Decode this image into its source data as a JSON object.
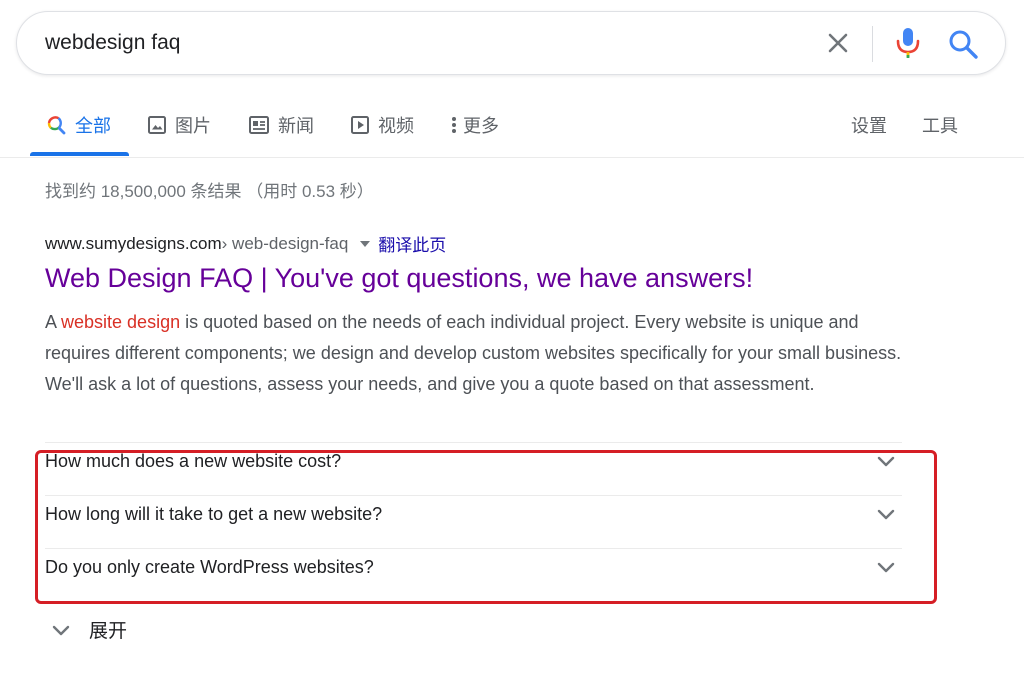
{
  "search": {
    "query": "webdesign faq"
  },
  "tabs": [
    {
      "label": "全部",
      "icon": "search-icon",
      "active": true
    },
    {
      "label": "图片",
      "icon": "image-icon"
    },
    {
      "label": "新闻",
      "icon": "news-icon"
    },
    {
      "label": "视频",
      "icon": "video-icon"
    },
    {
      "label": "更多",
      "icon": "more-vert-icon"
    }
  ],
  "tools": {
    "settings": "设置",
    "tools": "工具"
  },
  "stats": "找到约 18,500,000 条结果 （用时 0.53 秒）",
  "result": {
    "domain": "www.sumydesigns.com",
    "path": " › web-design-faq",
    "translate": "翻译此页",
    "title": "Web Design FAQ | You've got questions, we have answers!",
    "snippet_prefix": "A ",
    "snippet_highlight": "website design",
    "snippet_rest": " is quoted based on the needs of each individual project. Every website is unique and requires different components; we design and develop custom websites specifically for your small business. We'll ask a lot of questions, assess your needs, and give you a quote based on that assessment."
  },
  "faq": [
    {
      "question": "How much does a new website cost?"
    },
    {
      "question": "How long will it take to get a new website?"
    },
    {
      "question": "Do you only create WordPress websites?"
    }
  ],
  "expand_label": "展开",
  "colors": {
    "accent": "#1a73e8",
    "visited_title": "#660099",
    "highlight": "#d93025",
    "annotation_box": "#d51e25"
  }
}
